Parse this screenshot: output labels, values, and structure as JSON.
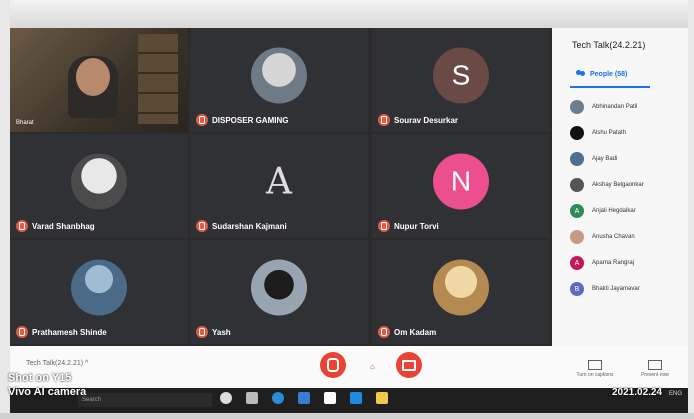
{
  "meeting": {
    "title": "Tech Talk(24.2.21)",
    "bottom_label": "Tech Talk(24.2.21)",
    "chevron": "^"
  },
  "participants_tiles": [
    {
      "name": "Bharat",
      "type": "camera"
    },
    {
      "name": "DISPOSER GAMING",
      "type": "photo"
    },
    {
      "name": "Sourav Desurkar",
      "type": "letter",
      "letter": "S",
      "color": "#6b4a45"
    },
    {
      "name": "Varad Shanbhag",
      "type": "photo"
    },
    {
      "name": "Sudarshan Kajmani",
      "type": "logo",
      "logo_letter": "A"
    },
    {
      "name": "Nupur Torvi",
      "type": "letter",
      "letter": "N",
      "color": "#ec4f8e"
    },
    {
      "name": "Prathamesh Shinde",
      "type": "photo"
    },
    {
      "name": "Yash",
      "type": "photo"
    },
    {
      "name": "Om Kadam",
      "type": "photo"
    }
  ],
  "sidebar": {
    "tab_label": "People (58)",
    "people": [
      {
        "name": "Abhinandan Patil",
        "avatar_color": "#6b7d8e",
        "letter": ""
      },
      {
        "name": "Alshu Patath",
        "avatar_color": "#111111",
        "letter": ""
      },
      {
        "name": "Ajay Badi",
        "avatar_color": "#4f6f8f",
        "letter": ""
      },
      {
        "name": "Akshay Belgaonkar",
        "avatar_color": "#555555",
        "letter": ""
      },
      {
        "name": "Anjali Hegdalkar",
        "avatar_color": "#2e8b57",
        "letter": "A"
      },
      {
        "name": "Anusha Chavan",
        "avatar_color": "#c89a85",
        "letter": ""
      },
      {
        "name": "Aparna Rangraj",
        "avatar_color": "#c2185b",
        "letter": "A"
      },
      {
        "name": "Bhakti Jayamavar",
        "avatar_color": "#5c6bc0",
        "letter": "B"
      }
    ]
  },
  "controls": {
    "captions_label": "Turn on captions",
    "present_label": "Present now"
  },
  "taskbar": {
    "search_text": "Search",
    "time": "ENG",
    "icons": [
      "start-icon",
      "taskview-icon",
      "edge-icon",
      "explorer-icon",
      "store-icon",
      "mail-icon",
      "files-icon"
    ]
  },
  "watermark": {
    "line1": "Shot on Y15",
    "line2": "Vivo AI camera",
    "date": "2021.02.24"
  }
}
